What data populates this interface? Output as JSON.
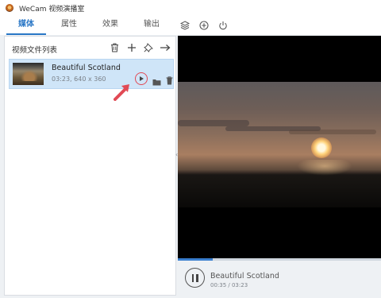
{
  "app": {
    "title": "WeCam 视频演播室"
  },
  "tabs": [
    {
      "label": "媒体",
      "active": true
    },
    {
      "label": "属性",
      "active": false
    },
    {
      "label": "效果",
      "active": false
    },
    {
      "label": "输出",
      "active": false
    }
  ],
  "toolbar_icons": [
    "layers-icon",
    "add-circle-icon",
    "power-icon"
  ],
  "panel": {
    "title": "视频文件列表",
    "actions": [
      "trash-icon",
      "add-icon",
      "pin-icon",
      "arrow-right-icon"
    ]
  },
  "videos": [
    {
      "name": "Beautiful Scotland",
      "meta": "03:23, 640 x 360",
      "actions": [
        "play-icon",
        "folder-icon",
        "trash-icon"
      ]
    }
  ],
  "player": {
    "now_title": "Beautiful Scotland",
    "time": "00:35 / 03:23",
    "progress": 0.172,
    "state": "playing"
  },
  "colors": {
    "accent": "#2a77c6",
    "selection": "#cfe5f8",
    "annotation": "#e14a55"
  }
}
